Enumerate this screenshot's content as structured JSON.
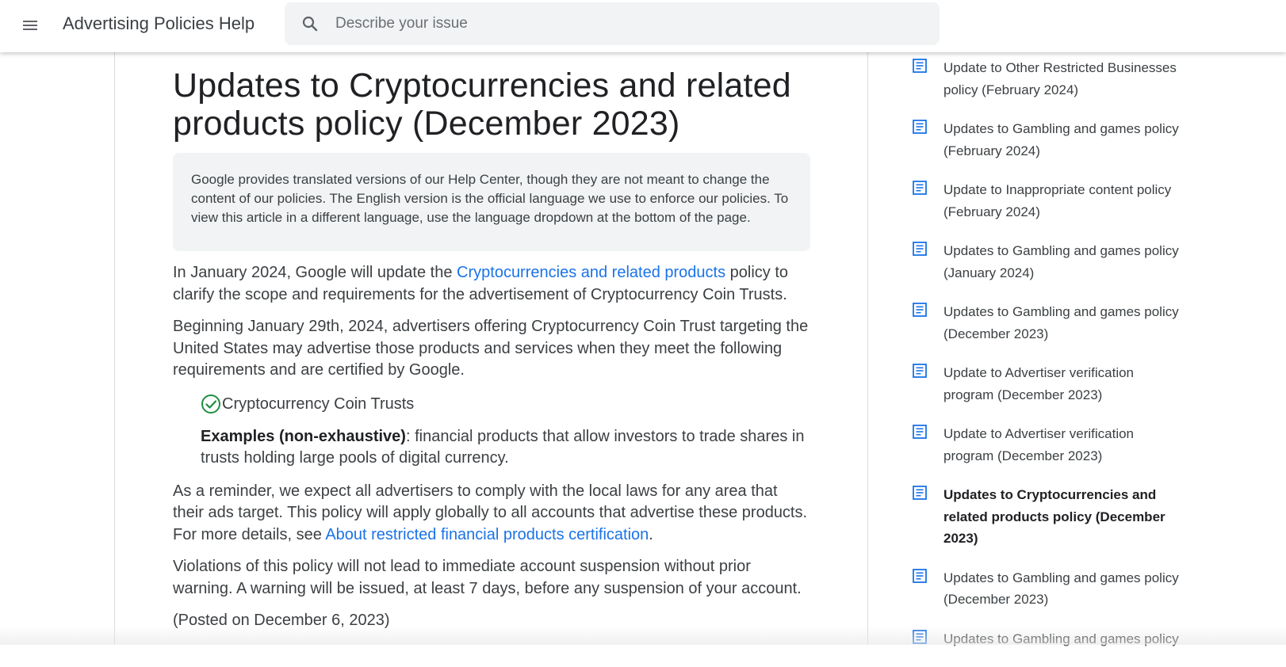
{
  "header": {
    "app_title": "Advertising Policies Help",
    "menu_icon": "hamburger-menu-icon",
    "search": {
      "placeholder": "Describe your issue",
      "value": "",
      "icon": "search-icon"
    }
  },
  "article": {
    "title": "Updates to Cryptocurrencies and related products policy (December 2023)",
    "notice": "Google provides translated versions of our Help Center, though they are not meant to change the content of our policies. The English version is the official language we use to enforce our policies. To view this article in a different language, use the language dropdown at the bottom of the page.",
    "p1": {
      "before": "In January 2024, Google will update the ",
      "link": "Cryptocurrencies and related products",
      "after": " policy to clarify the scope and requirements for the advertisement of Cryptocurrency Coin Trusts."
    },
    "p2": "Beginning January 29th, 2024, advertisers offering Cryptocurrency Coin Trust targeting the United States may advertise those products and services when they meet the following requirements and are certified by Google.",
    "check_item": "Cryptocurrency Coin Trusts",
    "examples": {
      "label": "Examples (non-exhaustive)",
      "text": ": financial products that allow investors to trade shares in trusts holding large pools of digital currency."
    },
    "p3": {
      "before": "As a reminder, we expect all advertisers to comply with the local laws for any area that their ads target. This policy will apply globally to all accounts that advertise these products. For more details, see ",
      "link": "About restricted financial products certification",
      "after": "."
    },
    "p4": "Violations of this policy will not lead to immediate account suspension without prior warning. A warning will be issued, at least 7 days, before any suspension of your account.",
    "posted": "(Posted on December 6, 2023)"
  },
  "sidebar": {
    "items": [
      {
        "label": "Update to Other Restricted Businesses policy (February 2024)",
        "active": false
      },
      {
        "label": "Updates to Gambling and games policy (February 2024)",
        "active": false
      },
      {
        "label": "Update to Inappropriate content policy (February 2024)",
        "active": false
      },
      {
        "label": "Updates to Gambling and games policy (January 2024)",
        "active": false
      },
      {
        "label": "Updates to Gambling and games policy (December 2023)",
        "active": false
      },
      {
        "label": "Update to Advertiser verification program (December 2023)",
        "active": false
      },
      {
        "label": "Update to Advertiser verification program (December 2023)",
        "active": false
      },
      {
        "label": "Updates to Cryptocurrencies and related products policy (December 2023)",
        "active": true
      },
      {
        "label": "Updates to Gambling and games policy (December 2023)",
        "active": false
      },
      {
        "label": "Updates to Gambling and games policy",
        "active": false
      }
    ],
    "icon": "article-icon"
  },
  "colors": {
    "link": "#1a73e8",
    "icon_blue": "#1a73e8",
    "check_green": "#1e8e3e",
    "notice_bg": "#f1f3f4"
  }
}
